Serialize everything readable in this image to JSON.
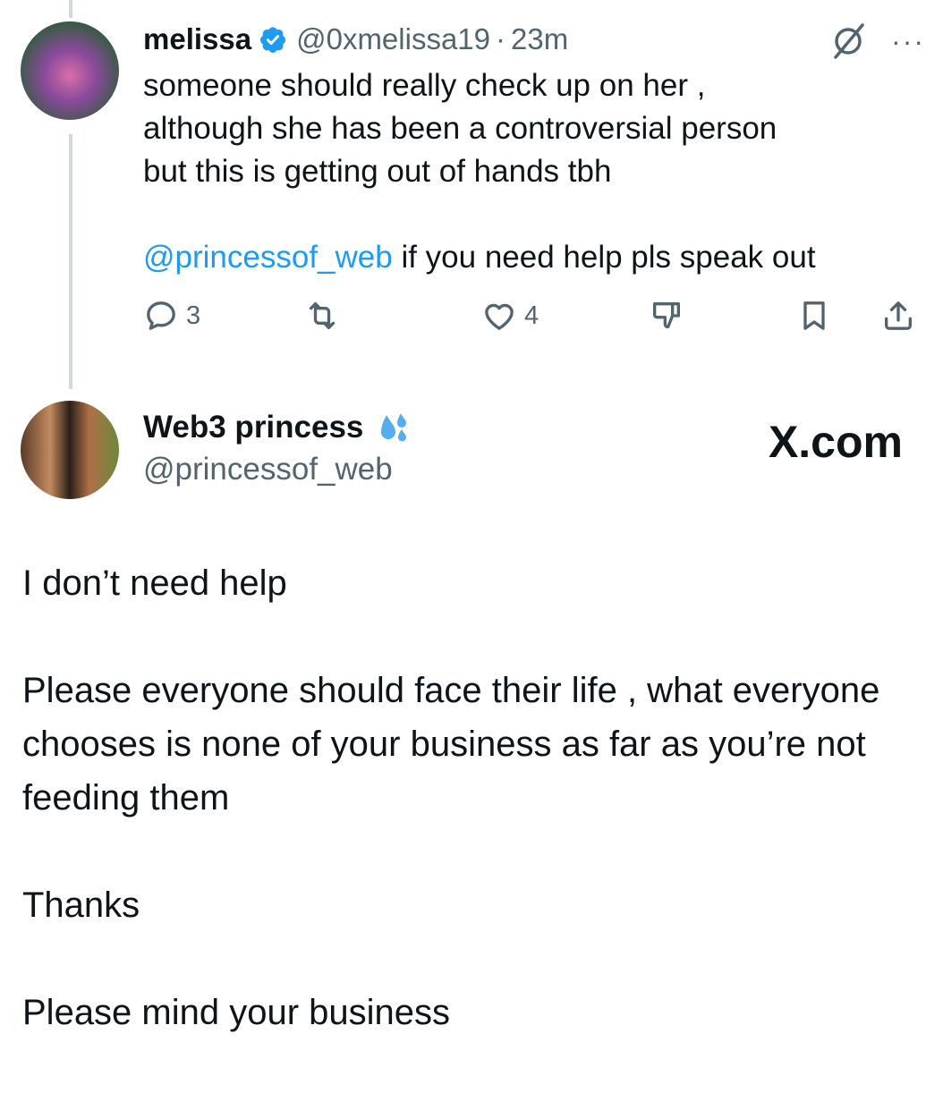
{
  "tweet1": {
    "name": "melissa",
    "handle": "@0xmelissa19",
    "separator": "·",
    "time": "23m",
    "more": "···",
    "lines": [
      "someone should really check up on her ,",
      "although she has been a controversial person",
      "but this is getting out of hands tbh"
    ],
    "mention": "@princessof_web",
    "mention_rest": " if you need help pls speak out",
    "replies": "3",
    "likes": "4"
  },
  "tweet2": {
    "name": "Web3 princess",
    "handle": "@princessof_web",
    "brand": "X.com",
    "paragraphs": [
      "I don’t need help",
      "Please everyone should face their life , what everyone chooses is none of your business as far as you’re not feeding them",
      "Thanks",
      "Please mind your business"
    ]
  },
  "colors": {
    "accent": "#1d9bf0",
    "secondary_text": "#536471",
    "thread_line": "#cfd9de"
  }
}
